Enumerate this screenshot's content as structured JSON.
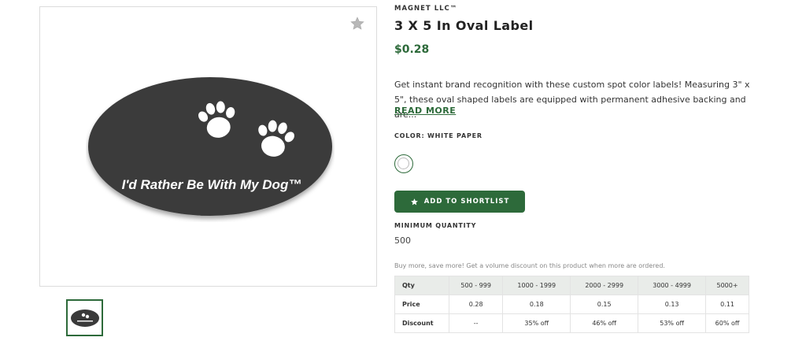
{
  "product": {
    "brand": "MAGNET LLC™",
    "title": "3 X 5 In Oval Label",
    "price": "$0.28",
    "description": "Get instant brand recognition with these custom spot color labels! Measuring 3\" x 5\", these oval shaped labels are equipped with permanent adhesive backing and are...",
    "read_more": "READ MORE",
    "color_label": "COLOR: WHITE PAPER",
    "shortlist_button": "ADD TO SHORTLIST",
    "min_quantity_label": "MINIMUM QUANTITY",
    "min_quantity": "500",
    "volume_note": "Buy more, save more! Get a volume discount on this product when more are ordered."
  },
  "image": {
    "label_text": "I'd Rather Be With My Dog™",
    "thumb_text": "I'd Rather Be With My Dog"
  },
  "pricing_table": {
    "header": [
      "Qty",
      "500 - 999",
      "1000 - 1999",
      "2000 - 2999",
      "3000 - 4999",
      "5000+"
    ],
    "rows": [
      [
        "Price",
        "0.28",
        "0.18",
        "0.15",
        "0.13",
        "0.11"
      ],
      [
        "Discount",
        "--",
        "35% off",
        "46% off",
        "53% off",
        "60% off"
      ]
    ]
  },
  "colors": {
    "accent": "#2d6a3a",
    "label_fill": "#3a3a3a",
    "table_header_bg": "#e9ece9"
  },
  "icons": {
    "favorite": "star-icon",
    "shortlist": "star-icon"
  }
}
